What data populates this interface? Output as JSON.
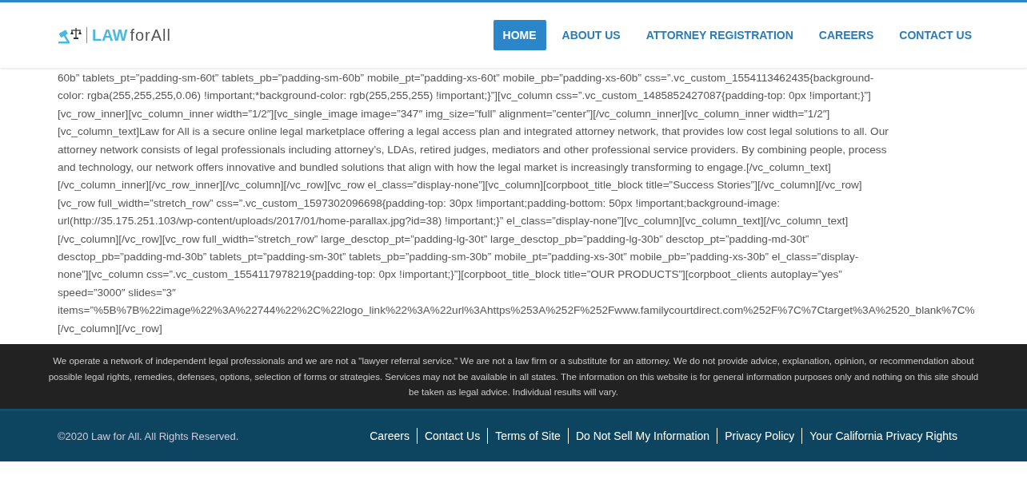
{
  "header": {
    "logo": {
      "strong": "LAW",
      "rest": "forAll"
    },
    "nav": [
      {
        "label": "HOME",
        "selected": true
      },
      {
        "label": "ABOUT US",
        "selected": false
      },
      {
        "label": "ATTORNEY REGISTRATION",
        "selected": false
      },
      {
        "label": "CAREERS",
        "selected": false
      },
      {
        "label": "CONTACT US",
        "selected": false
      }
    ]
  },
  "content_lines": [
    "60b” tablets_pt=”padding-sm-60t” tablets_pb=”padding-sm-60b” mobile_pt=”padding-xs-60t” mobile_pb=”padding-xs-60b” css=”.vc_custom_1554113462435{background-",
    "color: rgba(255,255,255,0.06) !important;*background-color: rgb(255,255,255) !important;}”][vc_column css=”.vc_custom_1485852427087{padding-top: 0px !important;}”]",
    "[vc_row_inner][vc_column_inner width=”1/2″][vc_single_image image=”347″ img_size=”full” alignment=”center”][/vc_column_inner][vc_column_inner width=”1/2″]",
    "[vc_column_text]Law for All is a secure online legal marketplace offering a legal access plan and integrated attorney network, that provides low cost legal solutions to all. Our",
    "attorney network consists of legal professionals including attorney’s, LDAs, retired judges, mediators and other professional service providers. By combining people, process",
    "and technology, our network offers innovative and bundled solutions that align with how the legal market is increasingly transforming to engage.[/vc_column_text]",
    "[/vc_column_inner][/vc_row_inner][/vc_column][/vc_row][vc_row el_class=”display-none”][vc_column][corpboot_title_block title=”Success Stories”][/vc_column][/vc_row]",
    "[vc_row full_width=”stretch_row” css=”.vc_custom_1597302096698{padding-top: 30px !important;padding-bottom: 50px !important;background-image:",
    "url(http://35.175.251.103/wp-content/uploads/2017/01/home-parallax.jpg?id=38) !important;}” el_class=”display-none”][vc_column][vc_column_text][/vc_column_text]",
    "[/vc_column][/vc_row][vc_row full_width=”stretch_row” large_desctop_pt=”padding-lg-30t” large_desctop_pb=”padding-lg-30b” desctop_pt=”padding-md-30t”",
    "desctop_pb=”padding-md-30b” tablets_pt=”padding-sm-30t” tablets_pb=”padding-sm-30b” mobile_pt=”padding-xs-30t” mobile_pb=”padding-xs-30b” el_class=”display-",
    "none”][vc_column css=”.vc_custom_1554117978219{padding-top: 0px !important;}”][corpboot_title_block title=”OUR PRODUCTS”][corpboot_clients autoplay=”yes”",
    "speed=”3000″ slides=”3″",
    "items=”%5B%7B%22image%22%3A%22744%22%2C%22logo_link%22%3A%22url%3Ahttps%253A%252F%252Fwww.familycourtdirect.com%252F%7C%7Ctarget%3A%2520_blank%7C%",
    "[/vc_column][/vc_row]"
  ],
  "disclaimer": "We operate a network of independent legal professionals and we are not a \"lawyer referral service.\" We are not a law firm or a substitute for an attorney. We do not provide advice, explanation, opinion, or recommendation about possible legal rights, remedies, defenses, options, selection of forms or strategies. Services may not be available in all states. The information on this website is for general information purposes only and nothing on this site should be taken as legal advice. Individual results will vary.",
  "footer": {
    "copyright": "©2020 Law for All. All Rights Reserved.",
    "links": [
      "Careers",
      "Contact Us",
      "Terms of Site",
      "Do Not Sell My Information",
      "Privacy Policy",
      "Your California Privacy Rights"
    ]
  }
}
